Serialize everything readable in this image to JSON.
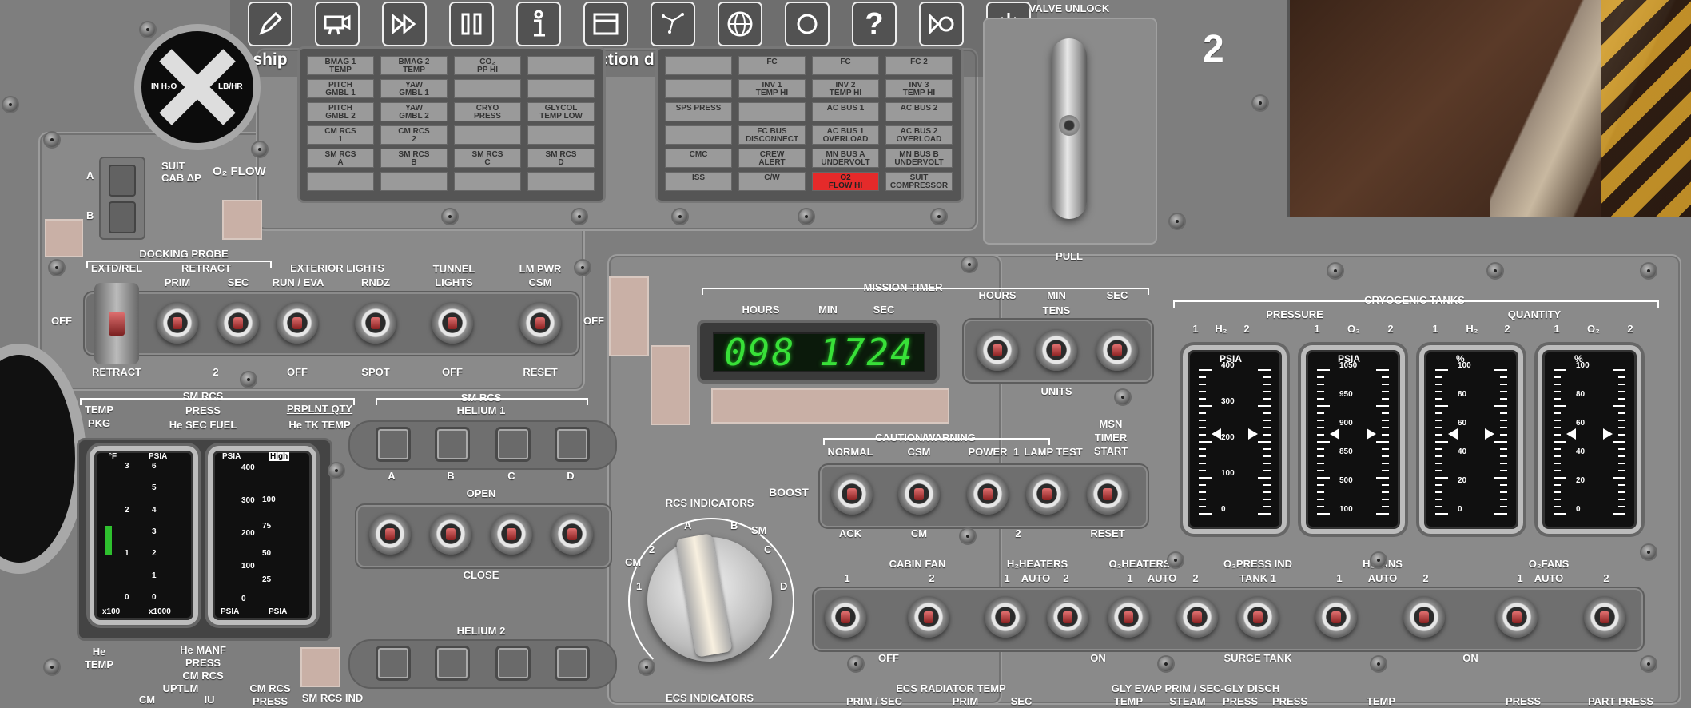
{
  "toolbar": {
    "items": [
      {
        "label": "ship",
        "icon": "pencil-icon"
      },
      {
        "label": "camera",
        "icon": "camera-icon"
      },
      {
        "label": "speed",
        "icon": "fast-forward-icon"
      },
      {
        "label": "pause",
        "icon": "pause-icon"
      },
      {
        "label": "info",
        "icon": "info-icon"
      },
      {
        "label": "function",
        "icon": "window-icon"
      },
      {
        "label": "display",
        "icon": "constellation-icon"
      },
      {
        "label": "map",
        "icon": "globe-icon"
      },
      {
        "label": "record",
        "icon": "record-icon"
      },
      {
        "label": "help",
        "icon": "question-icon"
      },
      {
        "label": "save",
        "icon": "save-icon"
      },
      {
        "label": "exit",
        "icon": "power-icon"
      }
    ]
  },
  "panel_number": "2",
  "valve": {
    "title": "VALVE UNLOCK",
    "pull": "PULL"
  },
  "suit": {
    "cab": "SUIT\nCAB ΔP",
    "o2flow": "O₂ FLOW",
    "a": "A",
    "b": "B",
    "dial_left": "IN H₂O",
    "dial_right": "LB/HR"
  },
  "cw_left": {
    "rows": [
      [
        "BMAG 1\nTEMP",
        "BMAG 2\nTEMP",
        "CO₂\nPP HI",
        ""
      ],
      [
        "PITCH\nGMBL 1",
        "YAW\nGMBL 1",
        "",
        ""
      ],
      [
        "PITCH\nGMBL 2",
        "YAW\nGMBL 2",
        "CRYO\nPRESS",
        "GLYCOL\nTEMP LOW"
      ],
      [
        "CM RCS\n1",
        "CM RCS\n2",
        "",
        ""
      ],
      [
        "SM RCS\nA",
        "SM RCS\nB",
        "SM RCS\nC",
        "SM RCS\nD"
      ],
      [
        "",
        "",
        "",
        ""
      ]
    ]
  },
  "cw_right": {
    "rows": [
      [
        "",
        "FC\n",
        "FC\n",
        "FC 2\n"
      ],
      [
        "",
        "INV 1\nTEMP HI",
        "INV 2\nTEMP HI",
        "INV 3\nTEMP HI"
      ],
      [
        "SPS PRESS",
        "",
        "AC BUS 1",
        "AC BUS 2"
      ],
      [
        "",
        "FC BUS\nDISCONNECT",
        "AC BUS 1\nOVERLOAD",
        "AC BUS 2\nOVERLOAD"
      ],
      [
        "CMC",
        "CREW\nALERT",
        "MN BUS A\nUNDERVOLT",
        "MN BUS B\nUNDERVOLT"
      ],
      [
        "ISS",
        "C/W",
        "O2\nFLOW HI",
        "SUIT\nCOMPRESSOR"
      ]
    ],
    "lit": "O2\nFLOW HI",
    "lit_color": "#e52a2a"
  },
  "row1": {
    "docking_probe": "DOCKING PROBE",
    "extd_rel": "EXTD/REL",
    "retract": "RETRACT",
    "prim": "PRIM",
    "sec": "SEC",
    "exterior_lights": "EXTERIOR LIGHTS",
    "run_eva": "RUN / EVA",
    "rndz": "RNDZ",
    "tunnel": "TUNNEL\nLIGHTS",
    "lm_pwr": "LM PWR\nCSM",
    "off_left": "OFF",
    "off_right": "OFF",
    "below": [
      "RETRACT",
      "2",
      "OFF",
      "SPOT",
      "OFF",
      "RESET"
    ]
  },
  "mission_timer": {
    "title": "MISSION TIMER",
    "hours": "HOURS",
    "min": "MIN",
    "sec": "SEC",
    "display": "098 1724",
    "display_color": "#38e038",
    "tens": "TENS",
    "units": "UNITS"
  },
  "cryo": {
    "title": "CRYOGENIC TANKS",
    "pressure": "PRESSURE",
    "quantity": "QUANTITY",
    "sublabels": [
      "1",
      "H₂",
      "2",
      "1",
      "O₂",
      "2",
      "1",
      "H₂",
      "2",
      "1",
      "O₂",
      "2"
    ],
    "gauges": [
      {
        "unit": "PSIA",
        "scale": [
          "400",
          "300",
          "200",
          "100",
          "0"
        ]
      },
      {
        "unit": "PSIA",
        "scale": [
          "1050",
          "950",
          "900",
          "850",
          "500",
          "100"
        ]
      },
      {
        "unit": "%",
        "scale": [
          "100",
          "80",
          "60",
          "40",
          "20",
          "0"
        ]
      },
      {
        "unit": "%",
        "scale": [
          "100",
          "80",
          "60",
          "40",
          "20",
          "0"
        ]
      }
    ]
  },
  "smrcs": {
    "title": "SM RCS",
    "temp_pkg": "TEMP\nPKG",
    "press": "PRESS",
    "he_sec_fuel": "He SEC FUEL",
    "prplnt": "PRPLNT QTY",
    "he_tk": "He TK TEMP",
    "helium1": "HELIUM 1",
    "abcd": [
      "A",
      "B",
      "C",
      "D"
    ],
    "open": "OPEN",
    "close": "CLOSE",
    "helium2": "HELIUM 2",
    "g1": {
      "top": "°F",
      "top2": "PSIA",
      "scale1": [
        "3",
        "2",
        "1",
        "0"
      ],
      "scale2": [
        "6",
        "5",
        "4",
        "3",
        "2",
        "1",
        "0"
      ],
      "bottom": [
        "x100",
        "x1000"
      ]
    },
    "g2": {
      "top": "PSIA",
      "top2": "High",
      "scale1": [
        "400",
        "300",
        "200",
        "100",
        "0"
      ],
      "scale2": [
        "100",
        "75",
        "50",
        "25"
      ],
      "bottom": [
        "PSIA",
        "PSIA"
      ]
    }
  },
  "rcs_indicators": {
    "title": "RCS INDICATORS",
    "positions": [
      "CM",
      "1",
      "2",
      "A",
      "B",
      "SM",
      "C",
      "D"
    ],
    "bottom": "ECS INDICATORS"
  },
  "caution": {
    "title": "CAUTION/WARNING",
    "normal": "NORMAL",
    "csm": "CSM",
    "power": "POWER",
    "one": "1",
    "lamp_test": "LAMP TEST",
    "msn": "MSN\nTIMER\nSTART",
    "boost": "BOOST",
    "ack": "ACK",
    "cm": "CM",
    "two": "2",
    "reset": "RESET"
  },
  "ecs_row": {
    "cabin_fan": "CABIN FAN",
    "h2_heaters": "H₂HEATERS",
    "o2_heaters": "O₂HEATERS",
    "o2_press": "O₂PRESS IND",
    "h2_fans": "H₂FANS",
    "o2_fans": "O₂FANS",
    "sub": [
      "1",
      "2",
      "1",
      "AUTO",
      "2",
      "1",
      "AUTO",
      "2",
      "TANK 1",
      "1",
      "AUTO",
      "2",
      "1",
      "AUTO",
      "2"
    ],
    "off": "OFF",
    "on1": "ON",
    "surge": "SURGE TANK",
    "on2": "ON"
  },
  "bottom_labels": {
    "he_temp": "He\nTEMP",
    "he_manf": "He MANF",
    "press": "PRESS",
    "cm_rcs": "CM RCS",
    "uptlm": "UPTLM",
    "cm": "CM",
    "iu": "IU",
    "cm_rcs_press": "CM RCS\nPRESS",
    "sm_rcs_ind": "SM RCS IND",
    "ecs_rad": "ECS RADIATOR TEMP",
    "prim_sec": "PRIM / SEC",
    "prim": "PRIM",
    "sec": "SEC",
    "gly": "GLY EVAP PRIM / SEC-GLY DISCH",
    "temp": "TEMP",
    "steam": "STEAM",
    "press2": "PRESS",
    "press3": "PRESS",
    "temp2": "TEMP",
    "press4": "PRESS",
    "part_press": "PART PRESS"
  }
}
